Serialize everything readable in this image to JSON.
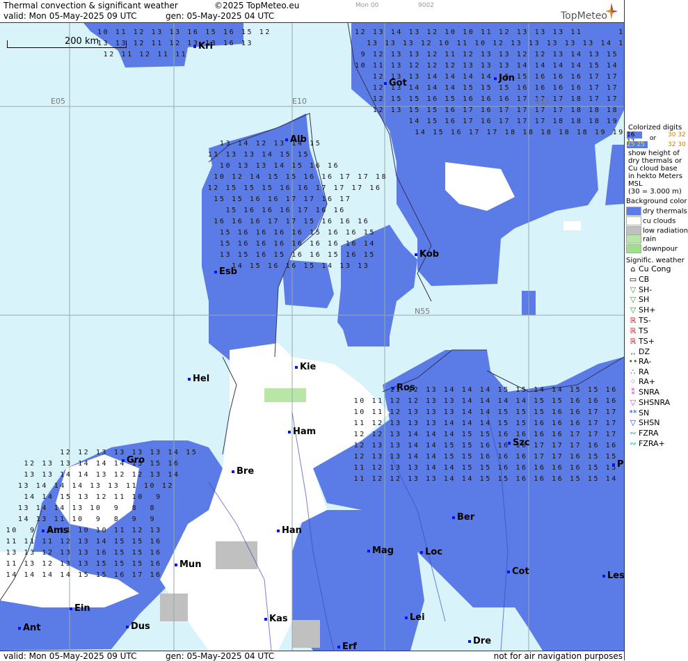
{
  "header": {
    "title": "Thermal convection & significant weather",
    "copyright": "©2025 TopMeteo.eu",
    "valid": "valid:  Mon  05-May-2025  09 UTC",
    "gen": "gen: 05-May-2025 04 UTC",
    "mon_tag": "Mon 00",
    "code_tag": "9002",
    "logo": "TopMeteo"
  },
  "footer": {
    "valid": "valid:  Mon  05-May-2025  09 UTC",
    "gen": "gen: 05-May-2025 04 UTC",
    "note": "not for air navigation purposes"
  },
  "map": {
    "scale_label": "200 km",
    "grid_labels": [
      "E05",
      "E10",
      "E15",
      "N55"
    ],
    "colors": {
      "sea": "#d9f3fb",
      "dry": "#5b7be6",
      "cu": "#ffffff",
      "low": "#c0c0c0",
      "rain": "#b9e6a6",
      "downpour": "#9fdf8a"
    },
    "cities": [
      {
        "name": "Kri"
      },
      {
        "name": "Got"
      },
      {
        "name": "Jon"
      },
      {
        "name": "Alb"
      },
      {
        "name": "Esb"
      },
      {
        "name": "Kob"
      },
      {
        "name": "Kie"
      },
      {
        "name": "Hel"
      },
      {
        "name": "Ros"
      },
      {
        "name": "Ham"
      },
      {
        "name": "Szc"
      },
      {
        "name": "Gro"
      },
      {
        "name": "Bre"
      },
      {
        "name": "Ams"
      },
      {
        "name": "Han"
      },
      {
        "name": "Ber"
      },
      {
        "name": "Mag"
      },
      {
        "name": "Loc"
      },
      {
        "name": "Mun"
      },
      {
        "name": "Cot"
      },
      {
        "name": "Ein"
      },
      {
        "name": "Lei"
      },
      {
        "name": "Kas"
      },
      {
        "name": "Ant"
      },
      {
        "name": "Dus"
      },
      {
        "name": "Dre"
      },
      {
        "name": "Erf"
      },
      {
        "name": "Les"
      },
      {
        "name": "P"
      }
    ]
  },
  "legend": {
    "colorized_title": "Colorized digits",
    "digits_example_a": "16 17",
    "digits_or": "or",
    "digits_example_b": "30 32",
    "digits_example_c": "25 25",
    "digits_example_d": "32 30",
    "explain": [
      "show height of",
      "dry thermals or",
      "Cu cloud base",
      "in hekto Meters",
      "MSL",
      "(30 = 3.000 m)"
    ],
    "bg_title": "Background color",
    "bg_items": [
      {
        "label": "dry thermals",
        "color": "#5b7be6"
      },
      {
        "label": "cu clouds",
        "color": "#ffffff"
      },
      {
        "label": "low radiation",
        "color": "#c0c0c0"
      },
      {
        "label": "rain",
        "color": "#b9e6a6"
      },
      {
        "label": "downpour",
        "color": "#9fdf8a"
      }
    ],
    "wx_title": "Signific. weather",
    "wx_items": [
      {
        "label": "Cu Cong",
        "icon": "cu-cong-icon",
        "glyph": "⌂",
        "color": "#000"
      },
      {
        "label": "CB",
        "icon": "cb-icon",
        "glyph": "▭",
        "color": "#000"
      },
      {
        "label": "SH-",
        "icon": "shower-light-icon",
        "glyph": "▽",
        "color": "#2a9a2a"
      },
      {
        "label": "SH",
        "icon": "shower-icon",
        "glyph": "▽",
        "color": "#2a9a2a"
      },
      {
        "label": "SH+",
        "icon": "shower-heavy-icon",
        "glyph": "▽",
        "color": "#2a9a2a"
      },
      {
        "label": "TS-",
        "icon": "thunder-light-icon",
        "glyph": "ℝ",
        "color": "#c02020"
      },
      {
        "label": "TS",
        "icon": "thunder-icon",
        "glyph": "ℝ",
        "color": "#c02020"
      },
      {
        "label": "TS+",
        "icon": "thunder-heavy-icon",
        "glyph": "ℝ",
        "color": "#c02020"
      },
      {
        "label": "DZ",
        "icon": "drizzle-icon",
        "glyph": ",,",
        "color": "#2a6a2a"
      },
      {
        "label": "RA-",
        "icon": "rain-light-icon",
        "glyph": "••",
        "color": "#2a6a2a"
      },
      {
        "label": "RA",
        "icon": "rain-icon",
        "glyph": "∴",
        "color": "#2a6a2a"
      },
      {
        "label": "RA+",
        "icon": "rain-heavy-icon",
        "glyph": "⁘",
        "color": "#2a6a2a"
      },
      {
        "label": "SNRA",
        "icon": "snow-rain-icon",
        "glyph": "⁑",
        "color": "#d030d0"
      },
      {
        "label": "SHSNRA",
        "icon": "shower-snow-rain-icon",
        "glyph": "▽",
        "color": "#d030d0"
      },
      {
        "label": "SN",
        "icon": "snow-icon",
        "glyph": "**",
        "color": "#2040d0"
      },
      {
        "label": "SHSN",
        "icon": "shower-snow-icon",
        "glyph": "▽",
        "color": "#2040d0"
      },
      {
        "label": "FZRA",
        "icon": "freezing-rain-icon",
        "glyph": "∾",
        "color": "#20b0d0"
      },
      {
        "label": "FZRA+",
        "icon": "freezing-rain-heavy-icon",
        "glyph": "∾",
        "color": "#20b0d0"
      }
    ]
  }
}
